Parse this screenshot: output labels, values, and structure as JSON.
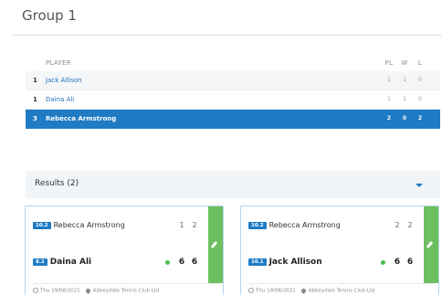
{
  "group": {
    "title": "Group 1"
  },
  "table": {
    "headers": {
      "player": "PLAYER",
      "pl": "PL",
      "w": "W",
      "l": "L"
    },
    "rows": [
      {
        "rank": "1",
        "name": "Jack Allison",
        "pl": "1",
        "w": "1",
        "l": "0"
      },
      {
        "rank": "1",
        "name": "Daina Ali",
        "pl": "1",
        "w": "1",
        "l": "0"
      },
      {
        "rank": "3",
        "name": "Rebecca Armstrong",
        "pl": "2",
        "w": "0",
        "l": "2"
      }
    ],
    "selected_index": 2
  },
  "results": {
    "title": "Results (2)",
    "cards": [
      {
        "p1": {
          "badge": "10.2",
          "name": "Rebecca Armstrong",
          "s1": "1",
          "s2": "2"
        },
        "p2": {
          "badge": "8.2",
          "name": "Daina Ali",
          "s1": "6",
          "s2": "6"
        },
        "date": "Thu 19/08/2021",
        "venue": "Abbeydale Tennis Club Ltd"
      },
      {
        "p1": {
          "badge": "10.2",
          "name": "Rebecca Armstrong",
          "s1": "2",
          "s2": "2"
        },
        "p2": {
          "badge": "10.1",
          "name": "Jack Allison",
          "s1": "6",
          "s2": "6"
        },
        "date": "Thu 19/08/2021",
        "venue": "Abbeydale Tennis Club Ltd"
      }
    ]
  },
  "colors": {
    "accent": "#1f7bc4",
    "edit": "#6cbf5f",
    "winner_dot": "#4cbf4c"
  }
}
